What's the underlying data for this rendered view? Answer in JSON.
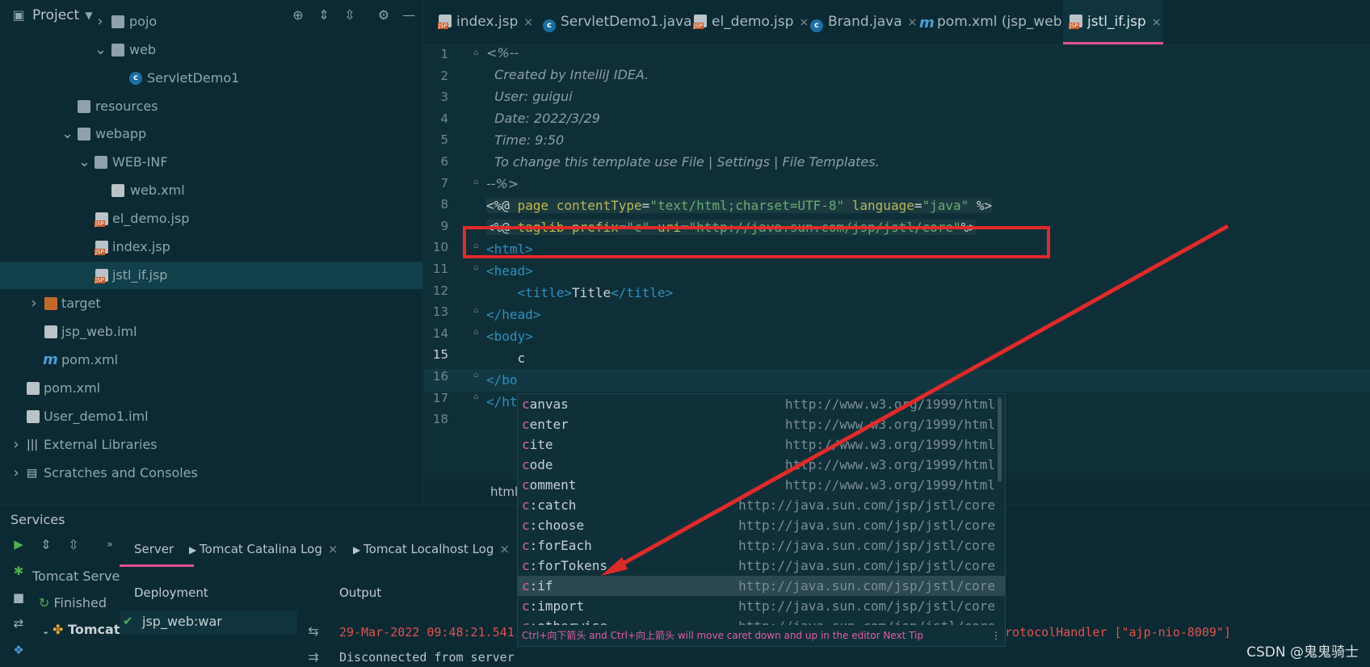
{
  "project_panel": {
    "title": "Project",
    "tree": [
      {
        "label": "pojo",
        "icon": "package-folder-icon",
        "arrow": "›"
      },
      {
        "label": "web",
        "icon": "package-folder-icon",
        "arrow": "⌄"
      },
      {
        "label": "ServletDemo1",
        "icon": "java-class-icon",
        "arrow": ""
      },
      {
        "label": "resources",
        "icon": "resources-folder-icon",
        "arrow": ""
      },
      {
        "label": "webapp",
        "icon": "web-folder-icon",
        "arrow": "⌄"
      },
      {
        "label": "WEB-INF",
        "icon": "folder-icon",
        "arrow": "⌄"
      },
      {
        "label": "web.xml",
        "icon": "xml-file-icon",
        "arrow": ""
      },
      {
        "label": "el_demo.jsp",
        "icon": "jsp-file-icon",
        "arrow": ""
      },
      {
        "label": "index.jsp",
        "icon": "jsp-file-icon",
        "arrow": ""
      },
      {
        "label": "jstl_if.jsp",
        "icon": "jsp-file-icon",
        "arrow": ""
      },
      {
        "label": "target",
        "icon": "orange-folder-icon",
        "arrow": "›"
      },
      {
        "label": "jsp_web.iml",
        "icon": "iml-file-icon",
        "arrow": ""
      },
      {
        "label": "pom.xml",
        "icon": "maven-icon",
        "arrow": ""
      },
      {
        "label": "pom.xml",
        "icon": "xml-file-icon",
        "arrow": ""
      },
      {
        "label": "User_demo1.iml",
        "icon": "iml-file-icon",
        "arrow": ""
      },
      {
        "label": "External Libraries",
        "icon": "libraries-icon",
        "arrow": "›"
      },
      {
        "label": "Scratches and Consoles",
        "icon": "scratches-icon",
        "arrow": "›"
      }
    ]
  },
  "tabs": [
    {
      "label": "index.jsp",
      "icon": "jsp-file-icon"
    },
    {
      "label": "ServletDemo1.java",
      "icon": "java-class-icon"
    },
    {
      "label": "el_demo.jsp",
      "icon": "jsp-file-icon"
    },
    {
      "label": "Brand.java",
      "icon": "java-class-icon"
    },
    {
      "label": "pom.xml (jsp_web)",
      "icon": "maven-icon"
    },
    {
      "label": "jstl_if.jsp",
      "icon": "jsp-file-icon"
    }
  ],
  "tab_close": "×",
  "editor": {
    "lines": [
      "1",
      "2",
      "3",
      "4",
      "5",
      "6",
      "7",
      "8",
      "9",
      "10",
      "11",
      "12",
      "13",
      "14",
      "15",
      "16",
      "17",
      "18"
    ],
    "code": {
      "l1": "<%--",
      "l2": "  Created by IntelliJ IDEA.",
      "l3": "  User: guigui",
      "l4": "  Date: 2022/3/29",
      "l5": "  Time: 9:50",
      "l6": "  To change this template use File | Settings | File Templates.",
      "l7": "--%>",
      "l8_open": "<%@ ",
      "l8_page": "page ",
      "l8_ct": "contentType",
      "l8_eq1": "=",
      "l8_ctv": "\"text/html;charset=UTF-8\"",
      "l8_lang": " language",
      "l8_eq2": "=",
      "l8_langv": "\"java\"",
      "l8_close": " %>",
      "l9_open": "<%@ ",
      "l9_taglib": "taglib ",
      "l9_prefix": "prefix",
      "l9_eq1": "=",
      "l9_prefixv": "\"c\"",
      "l9_uri": " uri",
      "l9_eq2": "=",
      "l9_uriv": "\"http://java.sun.com/jsp/jstl/core\"",
      "l9_close": "%>",
      "l10": "<html>",
      "l11": "<head>",
      "l12_a": "    <title>",
      "l12_b": "Title",
      "l12_c": "</title>",
      "l13": "</head>",
      "l14": "<body>",
      "l15": "    c",
      "l16": "</bo",
      "l17": "</ht"
    },
    "breadcrumb": "html"
  },
  "completion": {
    "items": [
      {
        "hl": "c",
        "rest": "anvas",
        "url": "http://www.w3.org/1999/html"
      },
      {
        "hl": "c",
        "rest": "enter",
        "url": "http://www.w3.org/1999/html"
      },
      {
        "hl": "c",
        "rest": "ite",
        "url": "http://www.w3.org/1999/html"
      },
      {
        "hl": "c",
        "rest": "ode",
        "url": "http://www.w3.org/1999/html"
      },
      {
        "hl": "c",
        "rest": "omment",
        "url": "http://www.w3.org/1999/html"
      },
      {
        "hl": "c",
        "rest": ":catch",
        "url": "http://java.sun.com/jsp/jstl/core"
      },
      {
        "hl": "c",
        "rest": ":choose",
        "url": "http://java.sun.com/jsp/jstl/core"
      },
      {
        "hl": "c",
        "rest": ":forEach",
        "url": "http://java.sun.com/jsp/jstl/core"
      },
      {
        "hl": "c",
        "rest": ":forTokens",
        "url": "http://java.sun.com/jsp/jstl/core"
      },
      {
        "hl": "c",
        "rest": ":if",
        "url": "http://java.sun.com/jsp/jstl/core"
      },
      {
        "hl": "c",
        "rest": ":import",
        "url": "http://java.sun.com/jsp/jstl/core"
      },
      {
        "hl": "c",
        "rest": ":otherwise",
        "url": "http://java.sun.com/jsp/jstl/core"
      }
    ],
    "tip": "Ctrl+向下箭头 and Ctrl+向上箭头 will move caret down and up in the editor  Next Tip"
  },
  "services": {
    "title": "Services",
    "tabs": [
      {
        "label": "Server"
      },
      {
        "label": "Tomcat Catalina Log"
      },
      {
        "label": "Tomcat Localhost Log"
      }
    ],
    "tree": {
      "server": "Tomcat Serve",
      "finished": "Finished",
      "tomcat": "Tomcat"
    },
    "deployment_header": "Deployment",
    "output_header": "Output",
    "deployment_item": "jsp_web:war",
    "output_lines": [
      {
        "text": "29-Mar-2022 09:48:21.541",
        "color": "#e0534f"
      },
      {
        "text": "Disconnected from server",
        "color": "#b9c4cc"
      }
    ],
    "output_tail": "rotocolHandler [\"ajp-nio-8009\"]"
  },
  "watermark": "CSDN @鬼鬼骑士",
  "colors": {
    "accent": "#e4508f",
    "highlight_box": "#e02a2a",
    "arrow": "#e02a2a"
  }
}
